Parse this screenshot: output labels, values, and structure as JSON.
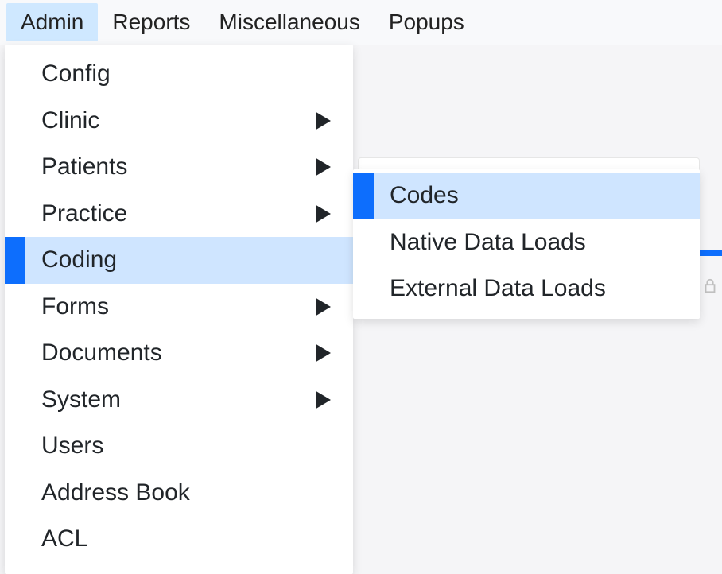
{
  "menubar": {
    "items": [
      {
        "label": "Admin",
        "active": true
      },
      {
        "label": "Reports",
        "active": false
      },
      {
        "label": "Miscellaneous",
        "active": false
      },
      {
        "label": "Popups",
        "active": false
      }
    ]
  },
  "dropdown": {
    "items": [
      {
        "label": "Config",
        "hasSubmenu": false,
        "highlighted": false
      },
      {
        "label": "Clinic",
        "hasSubmenu": true,
        "highlighted": false
      },
      {
        "label": "Patients",
        "hasSubmenu": true,
        "highlighted": false
      },
      {
        "label": "Practice",
        "hasSubmenu": true,
        "highlighted": false
      },
      {
        "label": "Coding",
        "hasSubmenu": true,
        "highlighted": true
      },
      {
        "label": "Forms",
        "hasSubmenu": true,
        "highlighted": false
      },
      {
        "label": "Documents",
        "hasSubmenu": true,
        "highlighted": false
      },
      {
        "label": "System",
        "hasSubmenu": true,
        "highlighted": false
      },
      {
        "label": "Users",
        "hasSubmenu": false,
        "highlighted": false
      },
      {
        "label": "Address Book",
        "hasSubmenu": false,
        "highlighted": false
      },
      {
        "label": "ACL",
        "hasSubmenu": false,
        "highlighted": false
      }
    ]
  },
  "submenu": {
    "items": [
      {
        "label": "Codes",
        "highlighted": true
      },
      {
        "label": "Native Data Loads",
        "highlighted": false
      },
      {
        "label": "External Data Loads",
        "highlighted": false
      }
    ]
  }
}
